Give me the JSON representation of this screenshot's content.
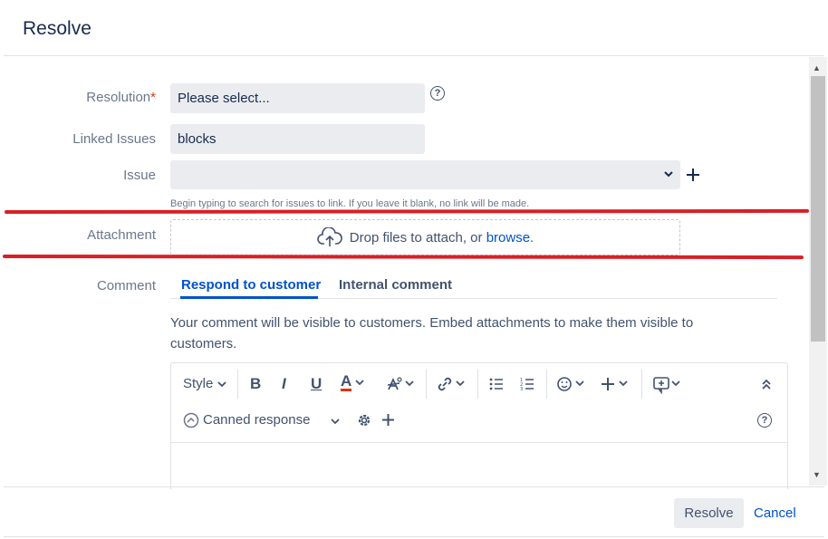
{
  "dialog": {
    "title": "Resolve"
  },
  "fields": {
    "resolution": {
      "label": "Resolution",
      "required_mark": "*",
      "value": "Please select..."
    },
    "linked_issues": {
      "label": "Linked Issues",
      "value": "blocks"
    },
    "issue": {
      "label": "Issue",
      "value": "",
      "hint": "Begin typing to search for issues to link. If you leave it blank, no link will be made."
    },
    "attachment": {
      "label": "Attachment",
      "drop_text": "Drop files to attach, or",
      "browse_link": "browse",
      "browse_suffix": "."
    },
    "comment": {
      "label": "Comment"
    }
  },
  "comment_tabs": [
    {
      "label": "Respond to customer",
      "active": true
    },
    {
      "label": "Internal comment",
      "active": false
    }
  ],
  "comment_note": "Your comment will be visible to customers. Embed attachments to make them visible to customers.",
  "toolbar": {
    "style_label": "Style",
    "bold": "B",
    "italic": "I",
    "underline": "U",
    "text_color": "A",
    "canned_response_label": "Canned response",
    "icons": [
      "chevron-down-icon",
      "text-color-icon",
      "clear-formatting-icon",
      "link-icon",
      "bullet-list-icon",
      "numbered-list-icon",
      "emoji-icon",
      "plus-icon",
      "macro-icon",
      "collapse-icon",
      "canned-response-icon",
      "gear-icon",
      "help-icon"
    ]
  },
  "footer": {
    "resolve_label": "Resolve",
    "cancel_label": "Cancel"
  },
  "colors": {
    "brand_blue": "#0052cc",
    "required_red": "#de350b",
    "annotation_red": "#d91f26",
    "text_primary": "#172b4d",
    "text_subtle": "#6b778c"
  }
}
